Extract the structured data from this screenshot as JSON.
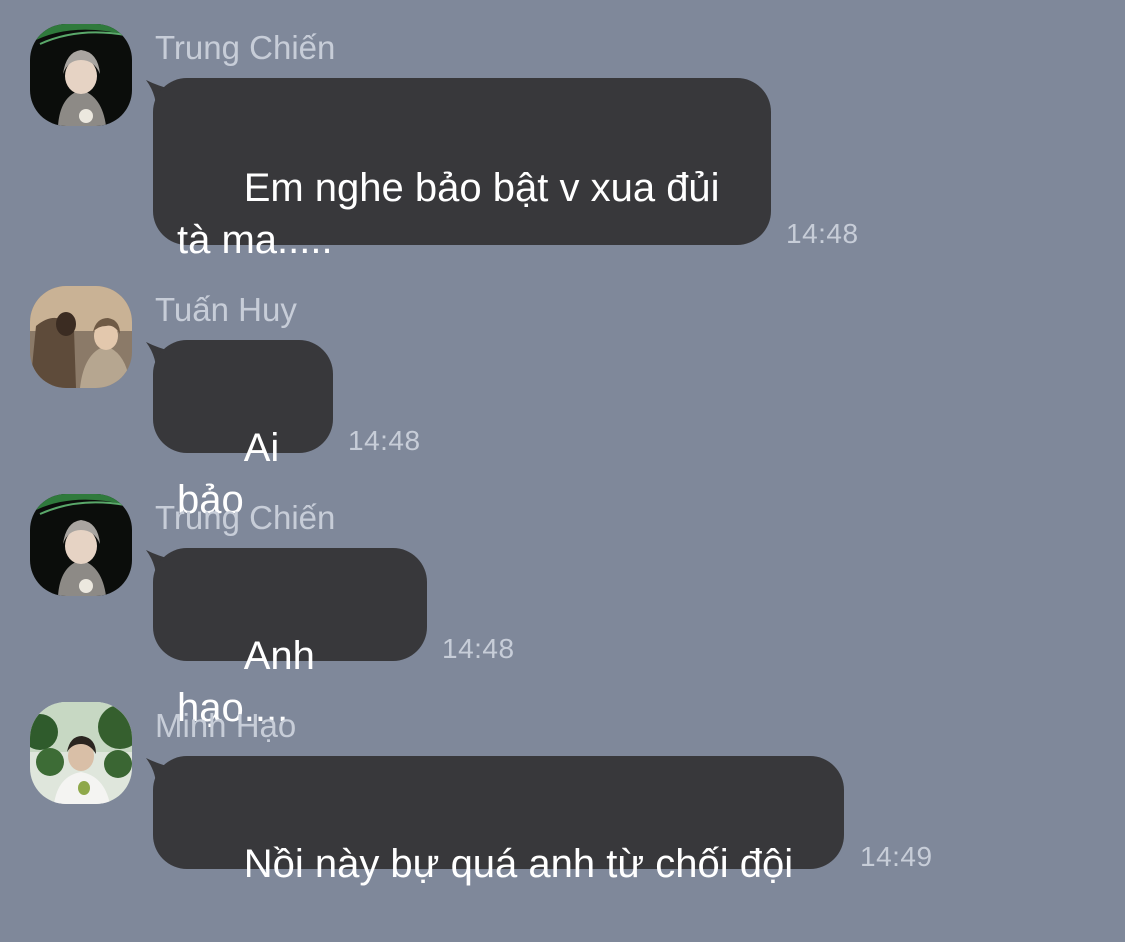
{
  "colors": {
    "background": "#7f889a",
    "bubble": "#38383b",
    "bubble_text": "#ffffff",
    "meta_text": "#c7cdd8"
  },
  "messages": [
    {
      "sender": "Trung Chiến",
      "text": "Em nghe bảo bật v xua đủi\ntà ma.....",
      "time": "14:48",
      "avatar": "avatar-trung-chien"
    },
    {
      "sender": "Tuấn Huy",
      "text": "Ai bảo",
      "time": "14:48",
      "avatar": "avatar-tuan-huy"
    },
    {
      "sender": "Trung Chiến",
      "text": "Anh hạo....",
      "time": "14:48",
      "avatar": "avatar-trung-chien"
    },
    {
      "sender": "Minh Hạo",
      "text": "Nồi này bự quá anh từ chối đội",
      "time": "14:49",
      "avatar": "avatar-minh-hao"
    }
  ]
}
